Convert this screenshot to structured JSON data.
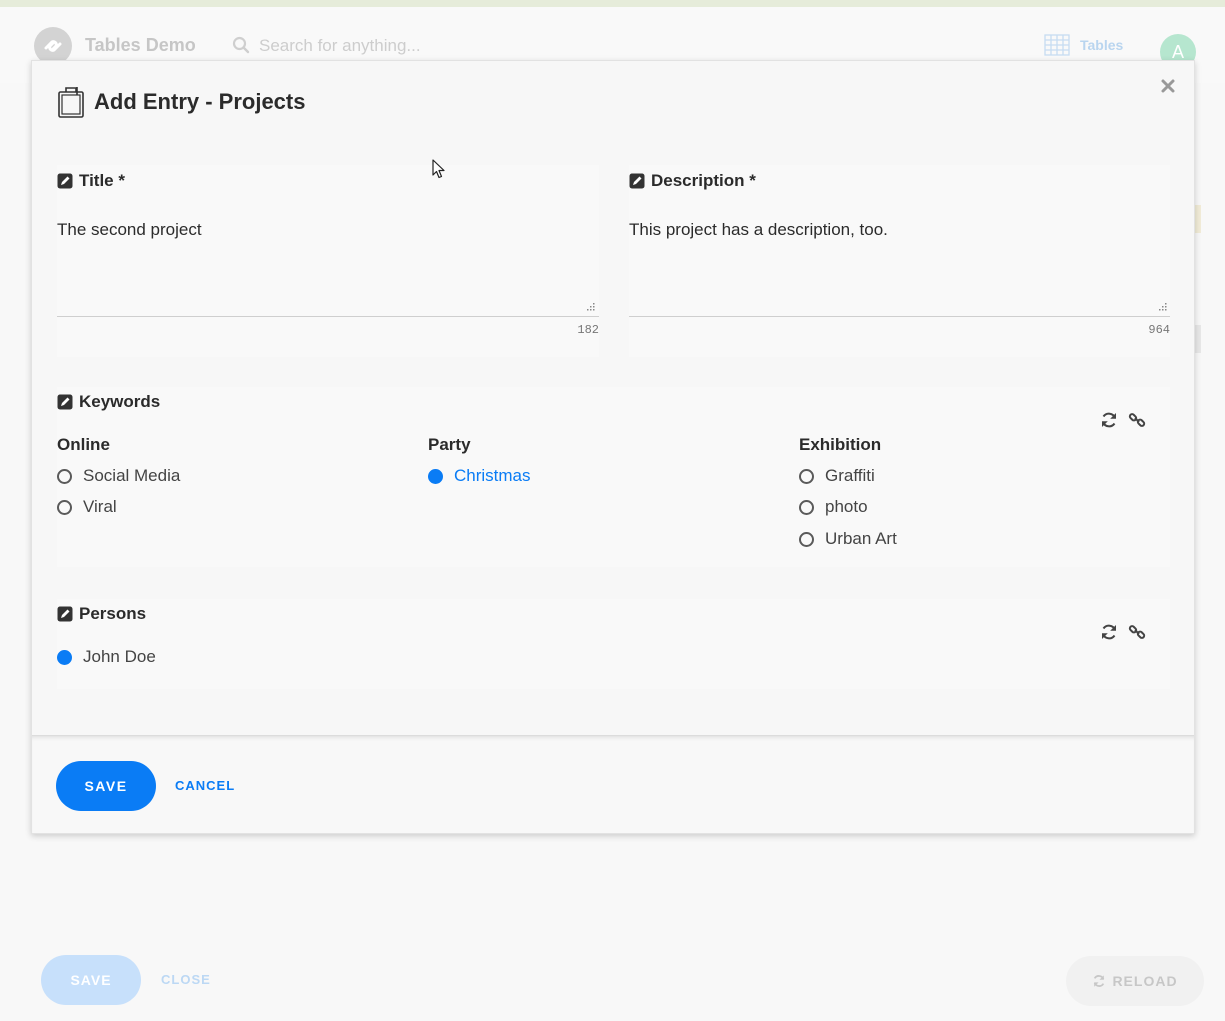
{
  "app": {
    "title": "Tables Demo",
    "search_placeholder": "Search for anything...",
    "nav_tables_label": "Tables",
    "avatar_initial": "A"
  },
  "background_actions": {
    "save_label": "SAVE",
    "close_label": "CLOSE",
    "reload_label": "RELOAD"
  },
  "modal": {
    "title": "Add Entry - Projects",
    "fields": {
      "title": {
        "label": "Title *",
        "value": "The second project",
        "counter": "182"
      },
      "description": {
        "label": "Description *",
        "value": "This project has a description, too.",
        "counter": "964"
      }
    },
    "keywords": {
      "label": "Keywords",
      "groups": [
        {
          "name": "Online",
          "options": [
            {
              "label": "Social Media",
              "checked": false
            },
            {
              "label": "Viral",
              "checked": false
            }
          ]
        },
        {
          "name": "Party",
          "options": [
            {
              "label": "Christmas",
              "checked": true
            }
          ]
        },
        {
          "name": "Exhibition",
          "options": [
            {
              "label": "Graffiti",
              "checked": false
            },
            {
              "label": "photo",
              "checked": false
            },
            {
              "label": "Urban Art",
              "checked": false
            }
          ]
        }
      ]
    },
    "persons": {
      "label": "Persons",
      "options": [
        {
          "label": "John Doe",
          "checked": true
        }
      ]
    },
    "footer": {
      "save_label": "SAVE",
      "cancel_label": "CANCEL"
    }
  },
  "colors": {
    "accent": "#0a7cf5",
    "background": "#f8f8f8",
    "text": "#2b2b2b"
  }
}
